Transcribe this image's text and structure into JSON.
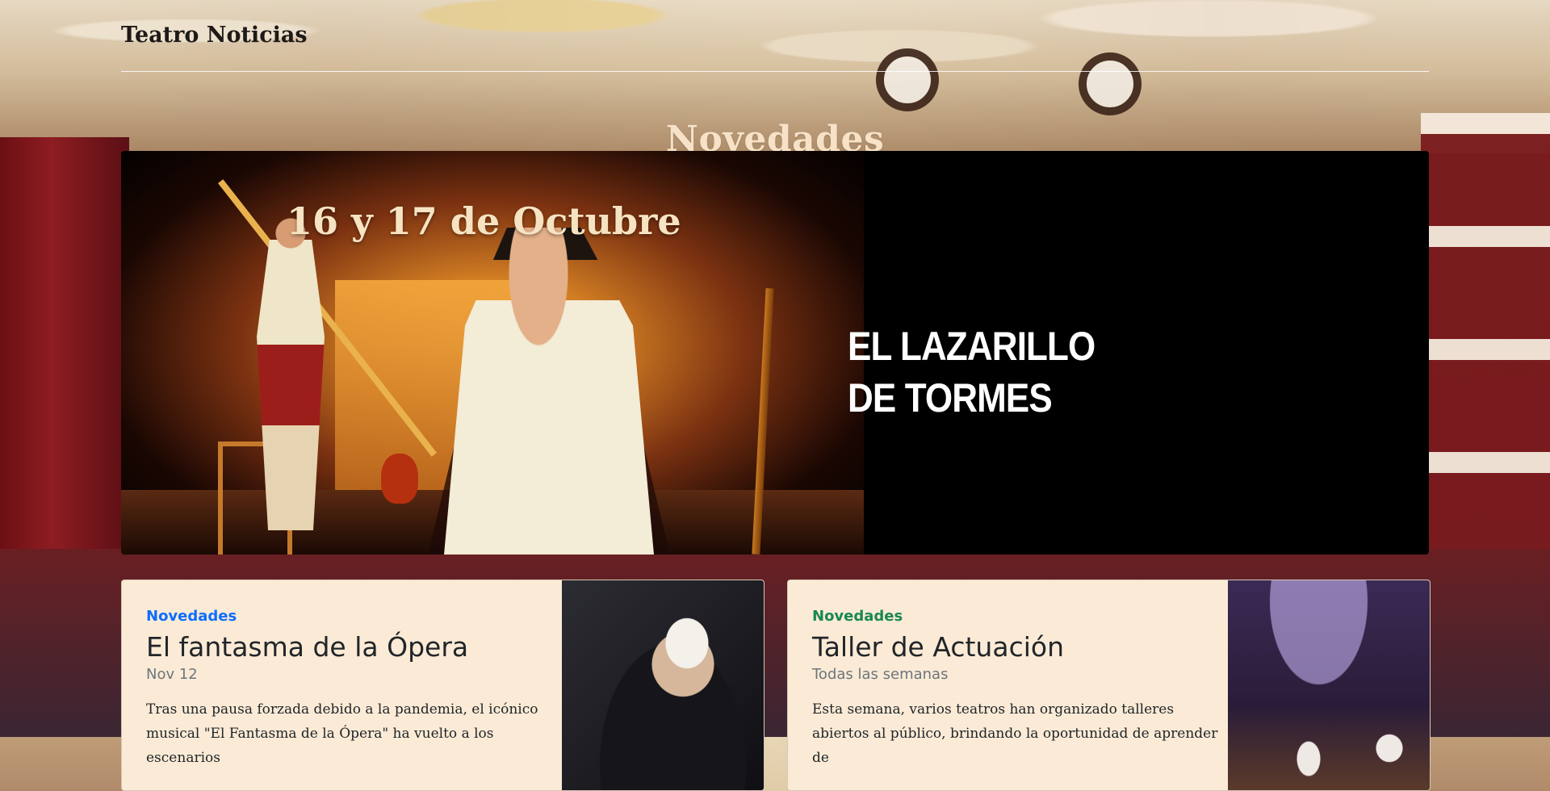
{
  "header": {
    "brand": "Teatro Noticias"
  },
  "section_title": "Novedades",
  "hero": {
    "date": "16 y 17 de Octubre",
    "title_line1": "EL LAZARILLO",
    "title_line2": "DE TORMES"
  },
  "cards": [
    {
      "category": "Novedades",
      "title": "El fantasma de la Ópera",
      "date": "Nov 12",
      "text": "Tras una pausa forzada debido a la pandemia, el icónico musical \"El Fantasma de la Ópera\" ha vuelto a los escenarios",
      "category_color": "#0d6efd"
    },
    {
      "category": "Novedades",
      "title": "Taller de Actuación",
      "date": "Todas las semanas",
      "text": "Esta semana, varios teatros han organizado talleres abiertos al público, brindando la oportunidad de aprender de",
      "category_color": "#198754"
    }
  ]
}
